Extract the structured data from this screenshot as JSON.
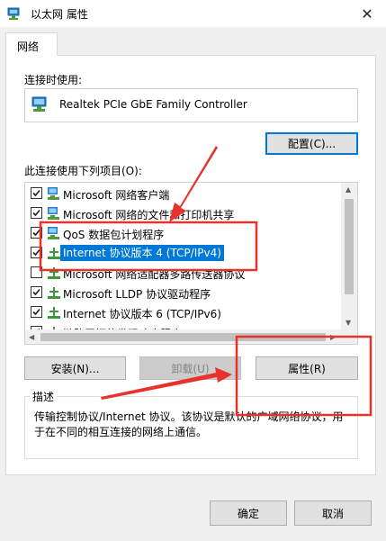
{
  "window": {
    "title": "以太网 属性",
    "close_glyph": "✕"
  },
  "tabs": [
    {
      "label": "网络"
    }
  ],
  "connect_using": {
    "label": "连接时使用:",
    "adapter_name": "Realtek PCIe GbE Family Controller",
    "configure_label": "配置(C)..."
  },
  "items_section": {
    "label": "此连接使用下列项目(O):",
    "items": [
      {
        "label": "Microsoft 网络客户端",
        "checked": true,
        "icon": "network-client-icon"
      },
      {
        "label": "Microsoft 网络的文件和打印机共享",
        "checked": true,
        "icon": "file-printer-sharing-icon"
      },
      {
        "label": "QoS 数据包计划程序",
        "checked": true,
        "icon": "qos-scheduler-icon"
      },
      {
        "label": "Internet 协议版本 4 (TCP/IPv4)",
        "checked": true,
        "icon": "protocol-icon",
        "selected": true
      },
      {
        "label": "Microsoft 网络适配器多路传送器协议",
        "checked": false,
        "icon": "protocol-icon"
      },
      {
        "label": "Microsoft LLDP 协议驱动程序",
        "checked": true,
        "icon": "protocol-icon"
      },
      {
        "label": "Internet 协议版本 6 (TCP/IPv6)",
        "checked": true,
        "icon": "protocol-icon"
      },
      {
        "label": "链路层拓扑发现响应程序",
        "checked": true,
        "icon": "protocol-icon"
      }
    ]
  },
  "buttons": {
    "install": "安装(N)...",
    "uninstall": "卸载(U)",
    "properties": "属性(R)",
    "ok": "确定",
    "cancel": "取消"
  },
  "description": {
    "title": "描述",
    "text": "传输控制协议/Internet 协议。该协议是默认的广域网络协议，用于在不同的相互连接的网络上通信。"
  },
  "colors": {
    "accent": "#0078d7",
    "annotation_red": "#e8322b"
  }
}
